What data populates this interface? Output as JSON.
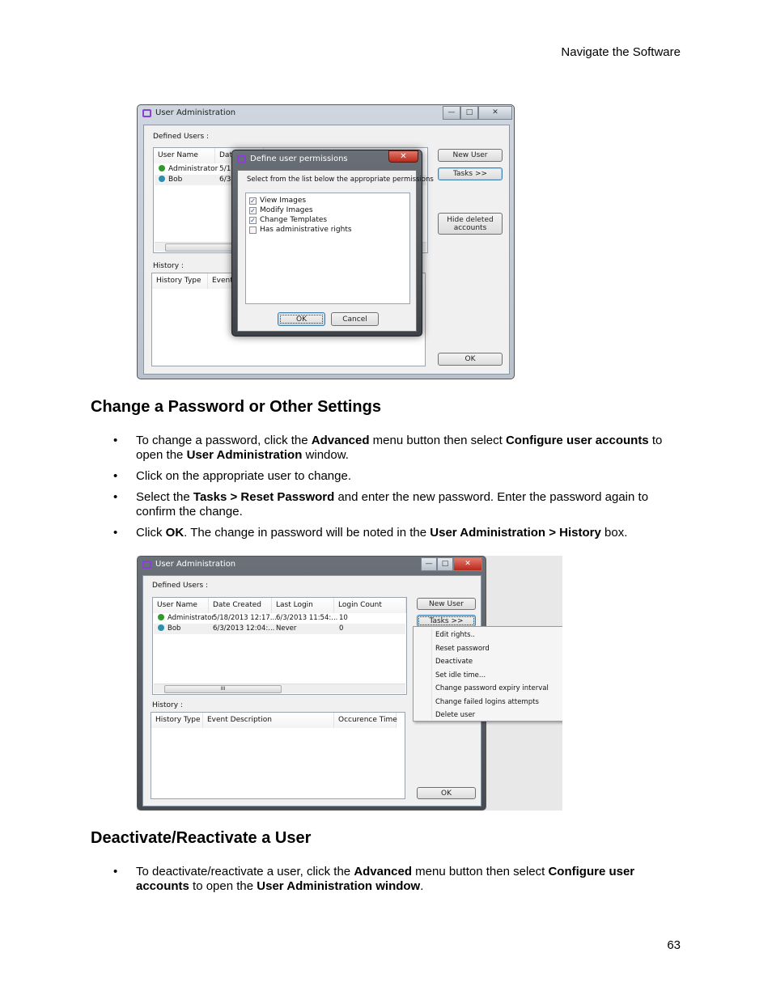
{
  "header": {
    "section": "Navigate the Software",
    "page_number": "63"
  },
  "shot1": {
    "title": "User Administration",
    "defined_users_label": "Defined Users :",
    "columns": [
      "User Name",
      "Date"
    ],
    "users": [
      {
        "name": "Administrator",
        "date": "5/1",
        "status": "active"
      },
      {
        "name": "Bob",
        "date": "6/3",
        "status": "active"
      }
    ],
    "history_label": "History :",
    "history_columns": [
      "History Type",
      "Event"
    ],
    "buttons": {
      "new_user": "New User",
      "tasks": "Tasks >>",
      "hide_deleted": "Hide deleted accounts",
      "ok": "OK"
    },
    "window_controls": {
      "minimize": "—",
      "maximize": "□",
      "close": "✕"
    },
    "dialog": {
      "title": "Define user permissions",
      "instruction": "Select from the list below the appropriate permissions",
      "permissions": [
        {
          "label": "View Images",
          "checked": true
        },
        {
          "label": "Modify Images",
          "checked": true
        },
        {
          "label": "Change Templates",
          "checked": true
        },
        {
          "label": "Has administrative rights",
          "checked": false
        }
      ],
      "ok": "OK",
      "cancel": "Cancel",
      "close": "✕"
    }
  },
  "section1": {
    "heading": "Change a Password or Other Settings",
    "bullets": [
      [
        {
          "t": "To change a password, click the "
        },
        {
          "t": "Advanced",
          "b": true
        },
        {
          "t": " menu button then select "
        },
        {
          "t": "Configure user accounts",
          "b": true
        },
        {
          "t": " to open the "
        },
        {
          "t": "User Administration",
          "b": true
        },
        {
          "t": " window."
        }
      ],
      [
        {
          "t": "Click on the appropriate user to change."
        }
      ],
      [
        {
          "t": "Select the "
        },
        {
          "t": "Tasks > Reset Password",
          "b": true
        },
        {
          "t": " and enter the new password. Enter the password again to confirm the change."
        }
      ],
      [
        {
          "t": "Click "
        },
        {
          "t": "OK",
          "b": true
        },
        {
          "t": ". The change in password will be noted in the "
        },
        {
          "t": "User Administration > History",
          "b": true
        },
        {
          "t": " box."
        }
      ]
    ]
  },
  "shot2": {
    "title": "User Administration",
    "defined_users_label": "Defined Users :",
    "columns": [
      "User Name",
      "Date Created",
      "Last Login",
      "Login Count"
    ],
    "users": [
      {
        "name": "Administrator",
        "date_created": "5/18/2013 12:17...",
        "last_login": "6/3/2013 11:54:...",
        "login_count": "10"
      },
      {
        "name": "Bob",
        "date_created": "6/3/2013 12:04:...",
        "last_login": "Never",
        "login_count": "0"
      }
    ],
    "history_label": "History :",
    "history_columns": [
      "History Type",
      "Event Description",
      "Occurence Time"
    ],
    "buttons": {
      "new_user": "New User",
      "tasks": "Tasks >>",
      "ok": "OK"
    },
    "scroll_thumb": "III",
    "tasks_menu": [
      "Edit rights..",
      "Reset password",
      "Deactivate",
      "Set idle time...",
      "Change password expiry interval",
      "Change failed logins attempts",
      "Delete user"
    ]
  },
  "section2": {
    "heading": "Deactivate/Reactivate a User",
    "bullets": [
      [
        {
          "t": "To deactivate/reactivate a user,  click the "
        },
        {
          "t": "Advanced",
          "b": true
        },
        {
          "t": " menu button then select "
        },
        {
          "t": "Configure user accounts",
          "b": true
        },
        {
          "t": " to open the "
        },
        {
          "t": "User Administration window",
          "b": true
        },
        {
          "t": "."
        }
      ]
    ]
  },
  "colors": {
    "active_green": "#2e9a2e",
    "active_teal": "#2d8fb0",
    "close_red": "#c8392b",
    "app_icon": "#8a3fd8"
  }
}
